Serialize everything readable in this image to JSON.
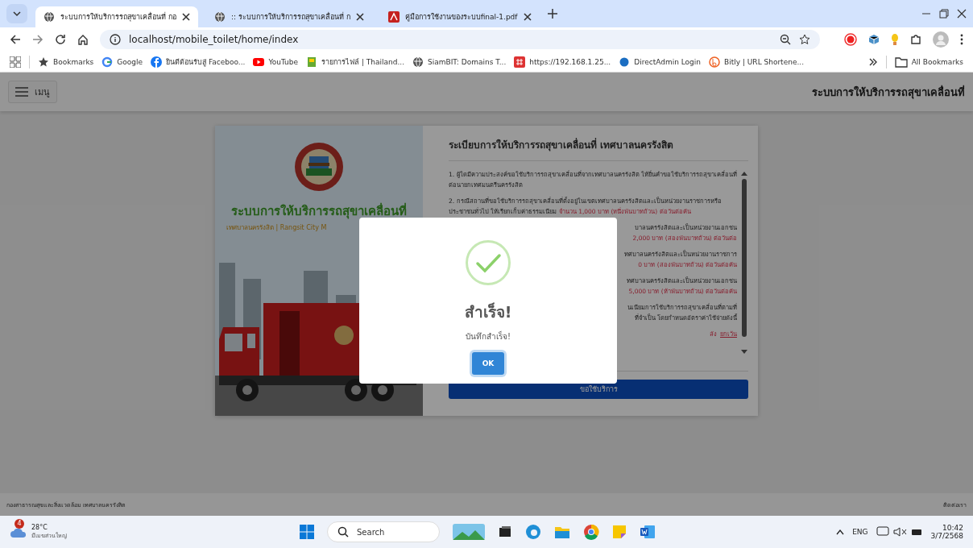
{
  "browser": {
    "tabs": [
      {
        "title": "ระบบการให้บริการรถสุขาเคลื่อนที่ กอ",
        "selected": true
      },
      {
        "title": ":: ระบบการให้บริการรถสุขาเคลื่อนที่ ก",
        "selected": false
      },
      {
        "title": "คู่มือการใช้งานของระบบfinal-1.pdf",
        "selected": false
      }
    ],
    "address": "localhost/mobile_toilet/home/index",
    "bookmarks": [
      "Bookmarks",
      "Google",
      "ยินดีต้อนรับสู่ Faceboo...",
      "YouTube",
      "รายการไฟล์ | Thailand...",
      "SiamBIT: Domains T...",
      "https://192.168.1.25...",
      "DirectAdmin Login",
      "Bitly | URL Shortene..."
    ],
    "all_bookmarks": "All Bookmarks"
  },
  "header": {
    "menu_label": "เมนู",
    "title": "ระบบการให้บริการรถสุขาเคลื่อนที่"
  },
  "card": {
    "system_title": "ระบบการให้บริการรถสุขาเคลื่อนที่",
    "subtitle": "เทศบาลนครรังสิต | Rangsit City M",
    "rules_title": "ระเบียบการให้บริการรถสุขาเคลื่อนที่ เทศบาลนครรังสิต",
    "rules": [
      {
        "kind": "full",
        "text": "1. ผู้ใดมีความประสงค์ขอใช้บริการรถสุขาเคลื่อนที่จากเทศบาลนครรังสิต ให้ยื่นคำขอใช้บริการรถสุขาเคลื่อนที่ ต่อนายกเทศมนตรีนครรังสิต"
      },
      {
        "kind": "full",
        "text": "2. กรณีสถานที่ขอใช้บริการรถสุขาเคลื่อนที่ตั้งอยู่ในเขตเทศบาลนครรังสิตและเป็นหน่วยงานราชการหรือประชาชนทั่วไป ให้เรียกเก็บค่าธรรมเนียม ",
        "fee": "จำนวน 1,000 บาท (หนึ่งพันบาทถ้วน) ต่อวันต่อคัน"
      },
      {
        "kind": "cut",
        "text": "บาลนครรังสิตและเป็นหน่วยงานเอกชน",
        "fee": "2,000 บาท (สองพันบาทถ้วน) ต่อวันต่อ"
      },
      {
        "kind": "cut",
        "text": "ทศบาลนครรังสิตและเป็นหน่วยงานราชการ",
        "fee": "0 บาท (สองพันบาทถ้วน) ต่อวันต่อคัน"
      },
      {
        "kind": "cut",
        "text": "ทศบาลนครรังสิตและเป็นหน่วยงานเอกชน",
        "fee": "5,000 บาท (ห้าพันบาทถ้วน) ต่อวันต่อคัน"
      },
      {
        "kind": "cut",
        "text": "นเนียมการใช้บริการรถสุขาเคลื่อนที่ตามที่",
        "text_2": "ที่จำเป็น โดยกำหนดอัตราค่าใช้จ่ายดังนี้"
      },
      {
        "kind": "cut",
        "fee": "ลัง",
        "link": "ยกเว้น"
      }
    ],
    "request_button": "ขอใช้บริการ"
  },
  "dialog": {
    "title": "สำเร็จ!",
    "message": "บันทึกสำเร็จ!",
    "ok": "OK"
  },
  "footer": {
    "left": "กองสาธารณสุขและสิ่งแวดล้อม เทศบาลนครรังสิต",
    "right": "ติดต่อเรา"
  },
  "taskbar": {
    "weather_badge": "4",
    "temperature": "28°C",
    "weather": "มีเมฆส่วนใหญ่",
    "search": "Search",
    "language": "ENG",
    "time": "10:42",
    "date": "3/7/2568"
  }
}
